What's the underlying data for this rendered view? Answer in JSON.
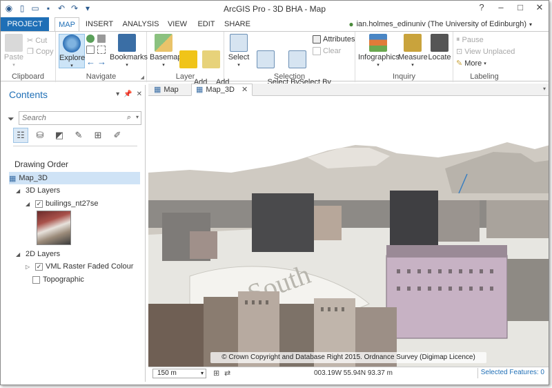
{
  "window": {
    "title": "ArcGIS Pro - 3D BHA - Map",
    "user": "ian.holmes_edinuniv (The University of Edinburgh)"
  },
  "ribbon_tabs": [
    "PROJECT",
    "MAP",
    "INSERT",
    "ANALYSIS",
    "VIEW",
    "EDIT",
    "SHARE"
  ],
  "active_tab": "MAP",
  "ribbon": {
    "clipboard": {
      "label": "Clipboard",
      "paste": "Paste",
      "cut": "Cut",
      "copy": "Copy"
    },
    "navigate": {
      "label": "Navigate",
      "explore": "Explore",
      "bookmarks": "Bookmarks"
    },
    "layer": {
      "label": "Layer",
      "basemap": "Basemap",
      "add_data": "Add\nData",
      "add_preset": "Add\nPreset"
    },
    "selection": {
      "label": "Selection",
      "select": "Select",
      "select_by_attributes": "Select By\nAttributes",
      "select_by_location": "Select By\nLocation",
      "attributes": "Attributes",
      "clear": "Clear"
    },
    "inquiry": {
      "label": "Inquiry",
      "infographics": "Infographics",
      "measure": "Measure",
      "locate": "Locate"
    },
    "labeling": {
      "label": "Labeling",
      "pause": "Pause",
      "view_unplaced": "View Unplaced",
      "more": "More"
    }
  },
  "contents": {
    "title": "Contents",
    "search_placeholder": "Search",
    "drawing_order_label": "Drawing Order",
    "map_name": "Map_3D",
    "group_3d": "3D Layers",
    "layer_buildings": "builings_nt27se",
    "group_2d": "2D Layers",
    "layer_vml": "VML Raster Faded Colour",
    "layer_topo": "Topographic"
  },
  "map_tabs": [
    {
      "label": "Map"
    },
    {
      "label": "Map_3D"
    }
  ],
  "map": {
    "copyright": "© Crown Copyright and Database Right 2015. Ordnance Survey (Digimap Licence)"
  },
  "status": {
    "scale": "150 m",
    "coords": "003.19W 55.94N   93.37 m",
    "selected_features": "Selected Features: 0"
  },
  "colors": {
    "accent": "#1f6fb6",
    "project_tab": "#1f6fb6"
  }
}
